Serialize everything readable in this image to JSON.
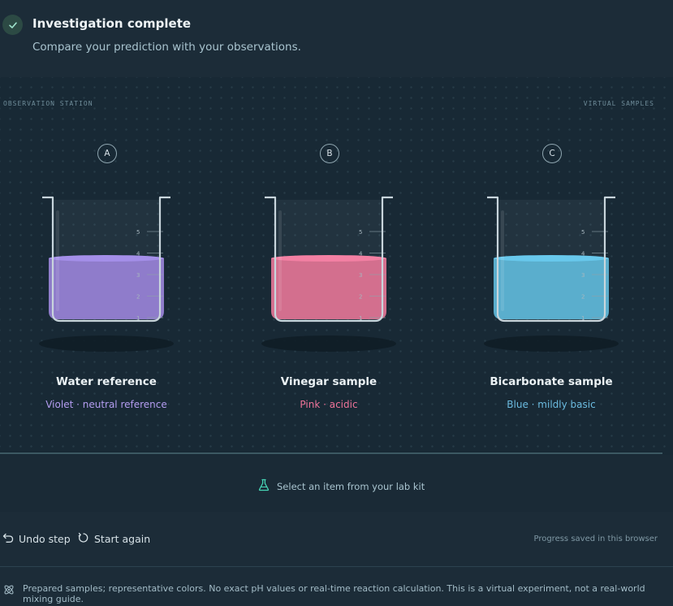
{
  "header": {
    "title": "Investigation complete",
    "subtitle": "Compare your prediction with your observations.",
    "status_icon": "check-icon"
  },
  "stage": {
    "left_label": "OBSERVATION STATION",
    "right_label": "VIRTUAL SAMPLES"
  },
  "beaker_scale": [
    "1",
    "2",
    "3",
    "4",
    "5"
  ],
  "samples": [
    {
      "letter": "A",
      "name": "Water reference",
      "description": "Violet · neutral reference",
      "liquid_color": "#8f7ccb",
      "desc_color": "#b39cf0"
    },
    {
      "letter": "B",
      "name": "Vinegar sample",
      "description": "Pink · acidic",
      "liquid_color": "#d36f8e",
      "desc_color": "#ee7399"
    },
    {
      "letter": "C",
      "name": "Bicarbonate sample",
      "description": "Blue · mildly basic",
      "liquid_color": "#5aaecd",
      "desc_color": "#6bbbe0"
    }
  ],
  "kit": {
    "prompt": "Select an item from your lab kit",
    "icon": "flask-icon"
  },
  "controls": {
    "undo_label": "Undo step",
    "restart_label": "Start again",
    "saved_note": "Progress saved in this browser"
  },
  "footer": {
    "text": "Prepared samples; representative colors. No exact pH values or real-time reaction calculation. This is a virtual experiment, not a real-world mixing guide.",
    "icon": "atom-icon"
  },
  "colors": {
    "accent": "#46d3b4",
    "background": "#1b2b36"
  }
}
